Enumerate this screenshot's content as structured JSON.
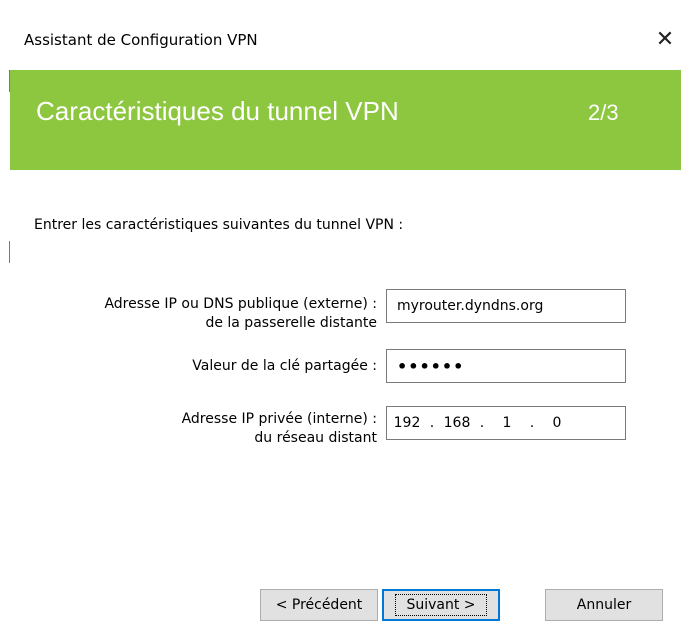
{
  "window": {
    "title": "Assistant de Configuration VPN",
    "close_glyph": "✕"
  },
  "header": {
    "title": "Caractéristiques du tunnel VPN",
    "step": "2/3",
    "accent_color": "#8dc63f"
  },
  "intro": "Entrer les caractéristiques suivantes du tunnel VPN :",
  "fields": {
    "remote_gateway": {
      "label": "Adresse IP ou DNS publique (externe) :\nde la passerelle distante",
      "value": "myrouter.dyndns.org"
    },
    "shared_key": {
      "label": "Valeur de la clé partagée :",
      "value": "••••••"
    },
    "remote_network": {
      "label": "Adresse IP privée (interne) :\ndu réseau distant",
      "octets": [
        "192",
        "168",
        "1",
        "0"
      ],
      "separator": "."
    }
  },
  "buttons": {
    "previous": "< Précédent",
    "next": "Suivant >",
    "cancel": "Annuler"
  }
}
